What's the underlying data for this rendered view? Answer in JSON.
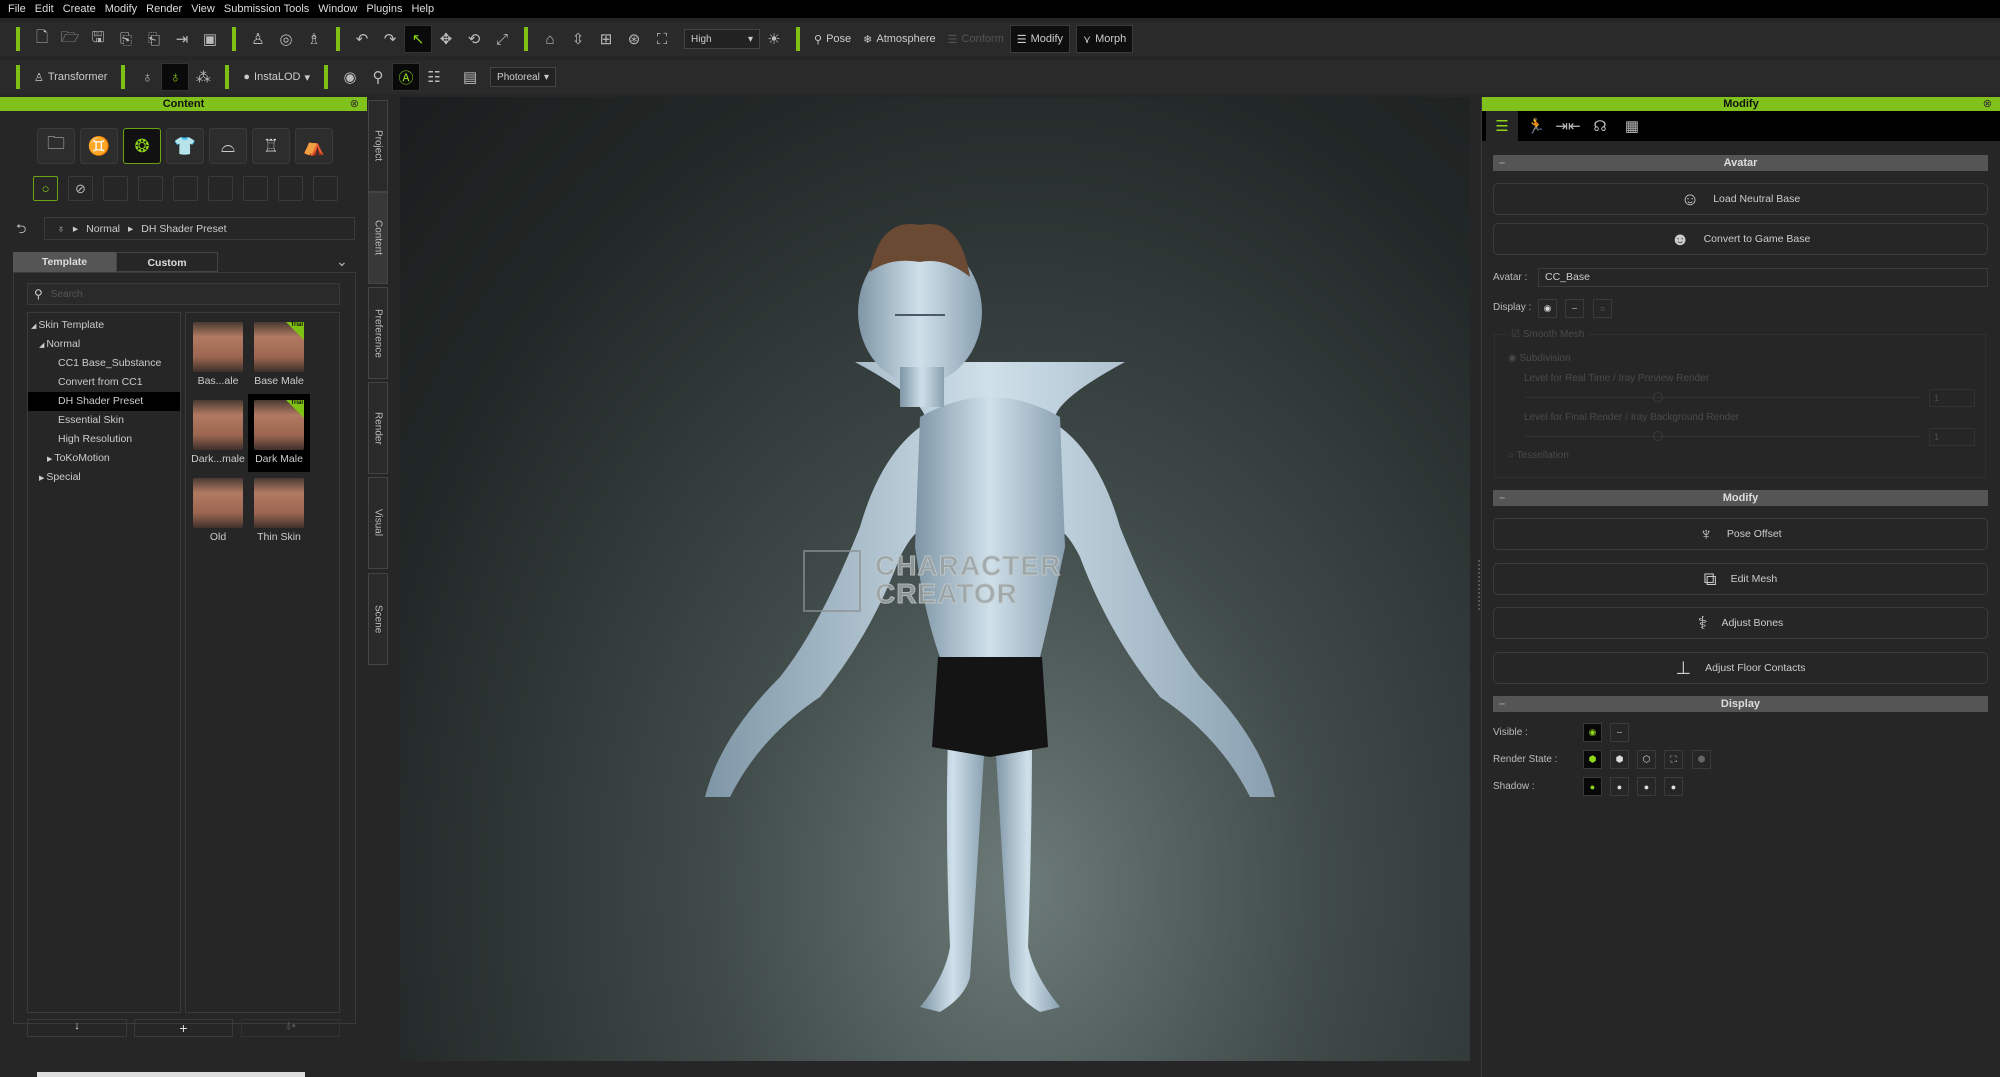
{
  "menu": [
    "File",
    "Edit",
    "Create",
    "Modify",
    "Render",
    "View",
    "Submission Tools",
    "Window",
    "Plugins",
    "Help"
  ],
  "toolbar1": {
    "quality": "High",
    "pose": "Pose",
    "atmosphere": "Atmosphere",
    "conform": "Conform",
    "modify": "Modify",
    "morph": "Morph"
  },
  "toolbar2": {
    "transformer": "Transformer",
    "instalod": "InstaLOD",
    "render_mode": "Photoreal"
  },
  "content_panel": {
    "title": "Content",
    "breadcrumb": [
      "Normal",
      "DH Shader Preset"
    ],
    "tabs": [
      "Template",
      "Custom"
    ],
    "search_placeholder": "Search",
    "tree": [
      {
        "label": "Skin Template",
        "level": 0,
        "arrow": "◢"
      },
      {
        "label": "Normal",
        "level": 1,
        "arrow": "◢"
      },
      {
        "label": "CC1 Base_Substance",
        "level": 2
      },
      {
        "label": "Convert from CC1",
        "level": 2
      },
      {
        "label": "DH Shader Preset",
        "level": 2,
        "selected": true
      },
      {
        "label": "Essential Skin",
        "level": 2
      },
      {
        "label": "High Resolution",
        "level": 2
      },
      {
        "label": "ToKoMotion",
        "level": 2,
        "arrow": "▶"
      },
      {
        "label": "Special",
        "level": 1,
        "arrow": "▶"
      }
    ],
    "thumbnails": [
      {
        "label": "Bas...ale",
        "trial": false
      },
      {
        "label": "Base Male",
        "trial": true
      },
      {
        "label": "Dark...male",
        "trial": false
      },
      {
        "label": "Dark Male",
        "trial": true,
        "selected": true
      },
      {
        "label": "Old",
        "trial": false
      },
      {
        "label": "Thin Skin",
        "trial": false
      }
    ],
    "trial_badge": "Trial"
  },
  "side_tabs": [
    "Project",
    "Content",
    "Preference",
    "Render",
    "Visual",
    "Scene"
  ],
  "viewport": {
    "watermark_line1": "CHARACTER",
    "watermark_line2": "CREATOR"
  },
  "modify_panel": {
    "title": "Modify",
    "avatar_section": "Avatar",
    "load_neutral": "Load Neutral Base",
    "convert_game": "Convert to Game Base",
    "avatar_label": "Avatar :",
    "avatar_value": "CC_Base",
    "display_label": "Display :",
    "smooth_mesh": "Smooth Mesh",
    "subdivision": "Subdivision",
    "level_realtime": "Level for Real Time / Iray Preview Render",
    "level_final": "Level for Final Render / Iray Background Render",
    "level_realtime_value": "1",
    "level_final_value": "1",
    "tessellation": "Tessellation",
    "modify_section": "Modify",
    "pose_offset": "Pose Offset",
    "edit_mesh": "Edit Mesh",
    "adjust_bones": "Adjust Bones",
    "adjust_floor": "Adjust Floor Contacts",
    "display_section": "Display",
    "visible_label": "Visible :",
    "render_state_label": "Render State :",
    "shadow_label": "Shadow :"
  },
  "colors": {
    "accent": "#80c11c",
    "panel": "#262626",
    "menubar": "#000000"
  }
}
